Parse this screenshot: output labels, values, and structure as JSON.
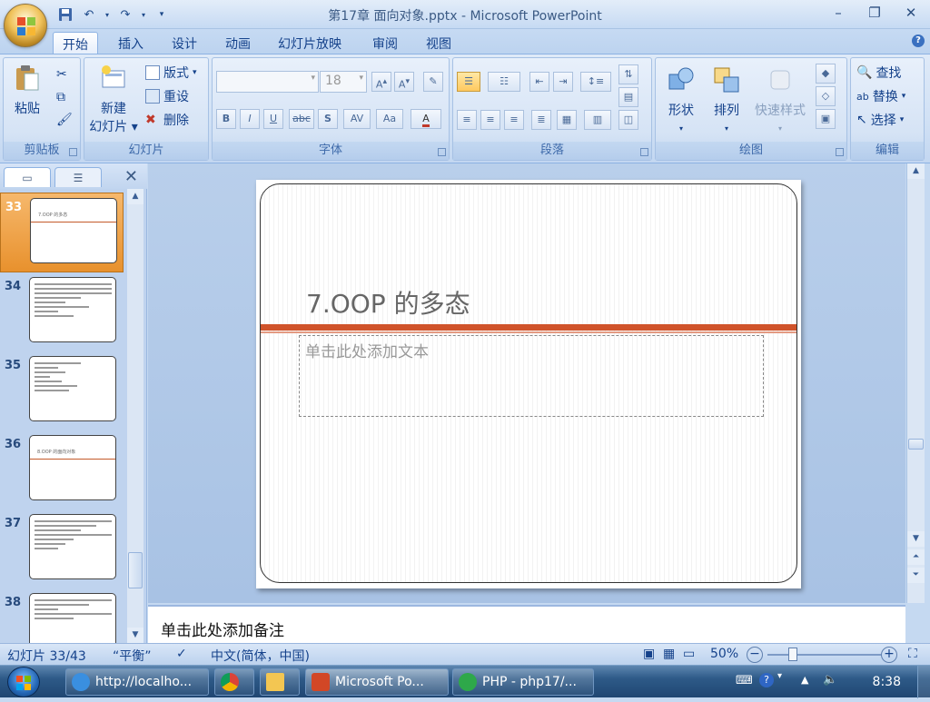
{
  "window": {
    "title": "第17章 面向对象.pptx - Microsoft PowerPoint"
  },
  "tabs": [
    {
      "label": "开始",
      "active": true
    },
    {
      "label": "插入"
    },
    {
      "label": "设计"
    },
    {
      "label": "动画"
    },
    {
      "label": "幻灯片放映"
    },
    {
      "label": "审阅"
    },
    {
      "label": "视图"
    }
  ],
  "ribbon": {
    "clipboard": {
      "group": "剪贴板",
      "paste": "粘贴"
    },
    "slides": {
      "group": "幻灯片",
      "new_slide_1": "新建",
      "new_slide_2": "幻灯片",
      "layout": "版式",
      "reset": "重设",
      "delete": "删除"
    },
    "font": {
      "group": "字体",
      "font_name": "",
      "font_size": "18"
    },
    "paragraph": {
      "group": "段落"
    },
    "drawing": {
      "group": "绘图",
      "shapes": "形状",
      "arrange": "排列",
      "quick_styles": "快速样式"
    },
    "editing": {
      "group": "编辑",
      "find": "查找",
      "replace": "替换",
      "select": "选择"
    }
  },
  "thumbnails": [
    {
      "num": "33",
      "selected": true,
      "title": "7.OOP 的多态"
    },
    {
      "num": "34",
      "kind": "text"
    },
    {
      "num": "35",
      "kind": "text"
    },
    {
      "num": "36",
      "title": "8.OOP 的面向对象"
    },
    {
      "num": "37",
      "kind": "text"
    },
    {
      "num": "38",
      "kind": "text"
    }
  ],
  "slide": {
    "title": "7.OOP 的多态",
    "body_placeholder": "单击此处添加文本",
    "accent_color": "#d0532a"
  },
  "notes": {
    "placeholder": "单击此处添加备注"
  },
  "statusbar": {
    "slide_info": "幻灯片 33/43",
    "theme": "“平衡”",
    "language": "中文(简体，中国)",
    "zoom": "50%"
  },
  "taskbar": {
    "items": [
      {
        "label": "http://localho...",
        "icon": "ie-icon"
      },
      {
        "label": "",
        "icon": "chrome-icon"
      },
      {
        "label": "",
        "icon": "folder-icon"
      },
      {
        "label": "Microsoft Po...",
        "icon": "powerpoint-icon",
        "active": true
      },
      {
        "label": "PHP - php17/...",
        "icon": "phpstorm-icon"
      }
    ],
    "clock": "8:38"
  }
}
